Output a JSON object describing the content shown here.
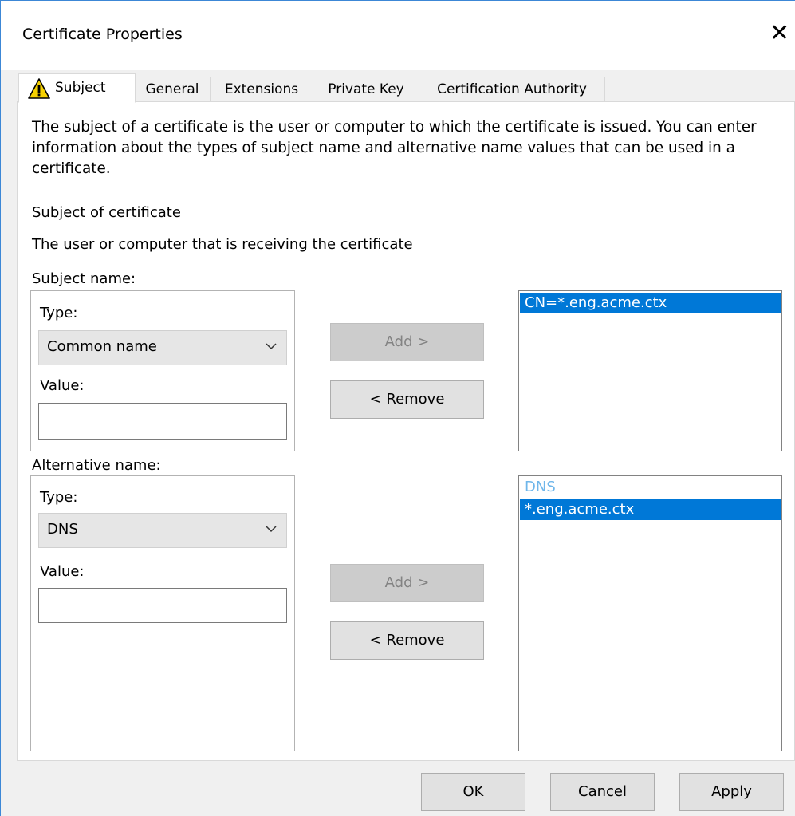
{
  "window": {
    "title": "Certificate Properties",
    "close_glyph": "✕"
  },
  "tabs": [
    {
      "label": "Subject",
      "active": true,
      "icon": "warning-icon"
    },
    {
      "label": "General"
    },
    {
      "label": "Extensions"
    },
    {
      "label": "Private Key"
    },
    {
      "label": "Certification Authority"
    }
  ],
  "subject_tab": {
    "description": "The subject of a certificate is the user or computer to which the certificate is issued. You can enter information about the types of subject name and alternative name values that can be used in a certificate.",
    "section_title": "Subject of certificate",
    "section_desc": "The user or computer that is receiving the certificate",
    "subject_name": {
      "label": "Subject name:",
      "type_label": "Type:",
      "type_value": "Common name",
      "value_label": "Value:",
      "value": "",
      "add_label": "Add >",
      "remove_label": "< Remove",
      "list": [
        {
          "text": "CN=*.eng.acme.ctx",
          "selected": true
        }
      ]
    },
    "alternative_name": {
      "label": "Alternative name:",
      "type_label": "Type:",
      "type_value": "DNS",
      "value_label": "Value:",
      "value": "",
      "add_label": "Add >",
      "remove_label": "< Remove",
      "list_group": "DNS",
      "list": [
        {
          "text": "*.eng.acme.ctx",
          "selected": true
        }
      ]
    }
  },
  "footer": {
    "ok_label": "OK",
    "cancel_label": "Cancel",
    "apply_label": "Apply"
  }
}
